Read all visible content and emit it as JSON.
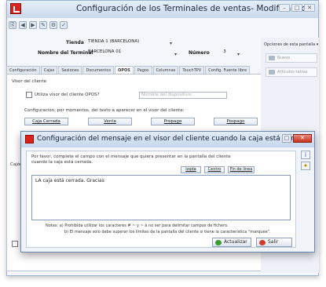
{
  "window": {
    "title": "Configuración de los Terminales de ventas- Modificando",
    "controls": [
      "–",
      "□",
      "✕"
    ]
  },
  "quick_access": [
    "⎘",
    "◀",
    "▶",
    "✎",
    "⚙",
    "✓"
  ],
  "header": {
    "tienda_label": "Tienda",
    "tienda_value": "TIENDA 1 (BARCELONA)",
    "terminal_label": "Nombre del Terminal",
    "terminal_value": "BARCELONA 01",
    "numero_label": "Número",
    "numero_value": "3"
  },
  "tabs": [
    {
      "label": "Configuración",
      "active": false
    },
    {
      "label": "Cajas",
      "active": false
    },
    {
      "label": "Sesiones",
      "active": false
    },
    {
      "label": "Documentos",
      "active": false
    },
    {
      "label": "OPOS",
      "active": true
    },
    {
      "label": "Pagos",
      "active": false
    },
    {
      "label": "Columnas",
      "active": false
    },
    {
      "label": "TouchTPV",
      "active": false
    },
    {
      "label": "Config. Fuente libre",
      "active": false
    }
  ],
  "opos": {
    "visor_title": "Visor del cliente",
    "utiliza_label": "Utiliza visor del cliente OPOS?",
    "dispositivo_placeholder": "Nombre del dispositivo",
    "config_text": "Configuración, por momentos, del texto a aparecer en el visor del cliente:",
    "moment_buttons": [
      "Caja Cerrada",
      "Venta",
      "Prepago",
      "Pospago"
    ],
    "cajon_label": "Cajón"
  },
  "right_panel": {
    "header": "Opciones de esta pantalla",
    "buttons": [
      "Nuevo",
      "Artículos tablas"
    ]
  },
  "dialog": {
    "title": "Configuración del mensaje en el visor del cliente cuando la caja está cerrada",
    "controls": [
      "□",
      "✕"
    ],
    "instructions_line1": "Por favor, complete el campo con el mensaje que quiera presentar en la pantalla del cliente",
    "instructions_line2": "cuando la caja está cerrada.",
    "align_buttons": [
      "Izqda",
      "Centro",
      "Fin de línea"
    ],
    "message": "LA caja está cerrada. Gracias",
    "notes_line1": "Notas: a) Prohibida utilizar los caracteres # ~ y ~ à no ser para delimitar campos de fichero.",
    "notes_line2": "b) El mensaje solo debe superar los límites de la pantalla del cliente si tiene la característica \"marquee\".",
    "actualizar_label": "Actualizar",
    "salir_label": "Salir"
  }
}
